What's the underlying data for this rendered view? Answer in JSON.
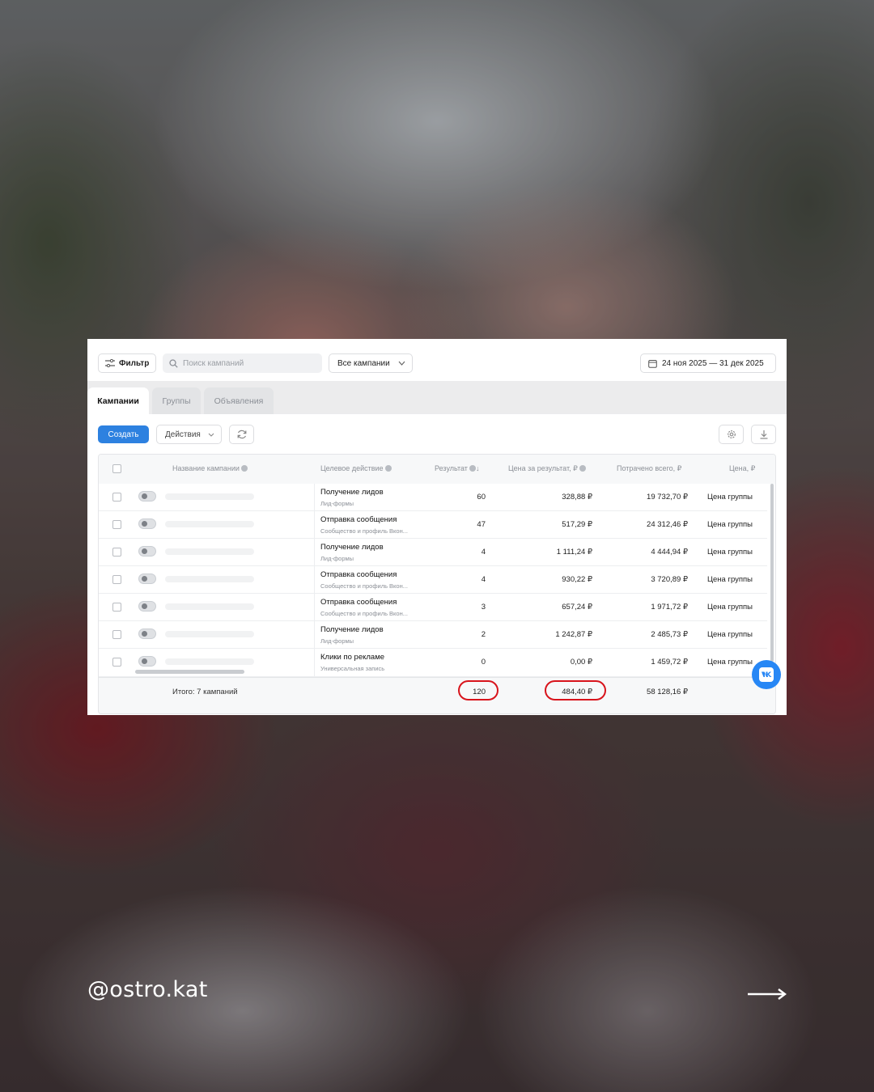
{
  "toolbar": {
    "filter_label": "Фильтр",
    "search_placeholder": "Поиск кампаний",
    "campaign_select": "Все кампании",
    "date_range": "24 ноя 2025 — 31 дек 2025"
  },
  "tabs": [
    {
      "label": "Кампании",
      "active": true
    },
    {
      "label": "Группы",
      "active": false
    },
    {
      "label": "Объявления",
      "active": false
    }
  ],
  "actions": {
    "create_label": "Создать",
    "actions_label": "Действия"
  },
  "table": {
    "headers": {
      "name": "Название кампании",
      "action": "Целевое действие",
      "result": "Результат",
      "cost_per_result": "Цена за результат, ₽",
      "spent": "Потрачено всего, ₽",
      "price": "Цена, ₽"
    },
    "rows": [
      {
        "action": "Получение лидов",
        "sub": "Лид-формы",
        "result": "60",
        "cost": "328,88 ₽",
        "spent": "19 732,70 ₽",
        "price": "Цена группы"
      },
      {
        "action": "Отправка сообщения",
        "sub": "Сообщество и профиль Вкон...",
        "result": "47",
        "cost": "517,29 ₽",
        "spent": "24 312,46 ₽",
        "price": "Цена группы"
      },
      {
        "action": "Получение лидов",
        "sub": "Лид-формы",
        "result": "4",
        "cost": "1 111,24 ₽",
        "spent": "4 444,94 ₽",
        "price": "Цена группы"
      },
      {
        "action": "Отправка сообщения",
        "sub": "Сообщество и профиль Вкон...",
        "result": "4",
        "cost": "930,22 ₽",
        "spent": "3 720,89 ₽",
        "price": "Цена группы"
      },
      {
        "action": "Отправка сообщения",
        "sub": "Сообщество и профиль Вкон...",
        "result": "3",
        "cost": "657,24 ₽",
        "spent": "1 971,72 ₽",
        "price": "Цена группы"
      },
      {
        "action": "Получение лидов",
        "sub": "Лид-формы",
        "result": "2",
        "cost": "1 242,87 ₽",
        "spent": "2 485,73 ₽",
        "price": "Цена группы"
      },
      {
        "action": "Клики по рекламе",
        "sub": "Универсальная запись",
        "result": "0",
        "cost": "0,00 ₽",
        "spent": "1 459,72 ₽",
        "price": "Цена группы"
      }
    ],
    "footer": {
      "label": "Итого: 7 кампаний",
      "result": "120",
      "cost": "484,40 ₽",
      "spent": "58 128,16 ₽"
    }
  },
  "overlay": {
    "handle": "@ostro.kat",
    "highlight_color": "#d8141c",
    "accent_color": "#2d81e0"
  }
}
